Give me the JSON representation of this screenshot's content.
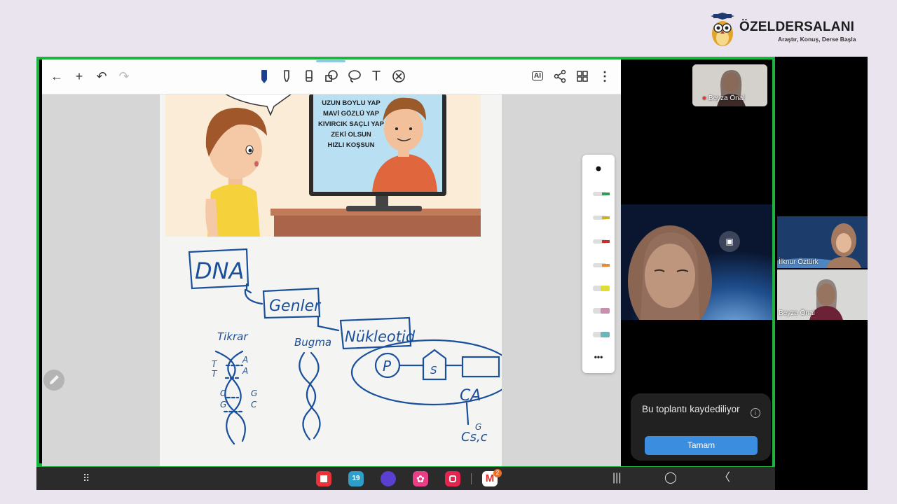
{
  "brand": {
    "name": "ÖZELDERSALANI",
    "tagline": "Araştır, Konuş, Derse Başla"
  },
  "toolbar": {
    "left_icons": [
      "back-arrow-icon",
      "plus-icon",
      "undo-icon",
      "redo-icon"
    ],
    "center_icons": [
      "pen-icon",
      "highlighter-icon",
      "eraser-icon",
      "shapes-icon",
      "lasso-icon",
      "text-icon",
      "close-circle-icon"
    ],
    "right_icons": [
      "ai-icon",
      "share-icon",
      "grid-icon",
      "more-vertical-icon"
    ],
    "ai_label": "AI"
  },
  "illustration": {
    "tv_lines": [
      "UZUN BOYLU YAP",
      "MAVİ GÖZLÜ YAP",
      "KIVIRCIK SAÇLI YAP",
      "ZEKİ OLSUN",
      "HIZLI KOŞSUN"
    ]
  },
  "handwriting": {
    "dna": "DNA",
    "genler": "Genler",
    "nukleotid": "Nükleotid",
    "tikrar": "Tikrar",
    "bugma": "Bugma",
    "p": "P",
    "s": "S",
    "ca": "CA",
    "g": "G",
    "csc": "Cs,c",
    "dna_letters": [
      "T",
      "A",
      "T",
      "A",
      "C",
      "G",
      "G",
      "C"
    ]
  },
  "pen_panel": {
    "colors": [
      "#111111",
      "#2e9d55",
      "#c9b320",
      "#c92d2d",
      "#e98a32",
      "#dedd36",
      "#c98fb1",
      "#6ab7b3"
    ],
    "more_label": "•••"
  },
  "participants": [
    {
      "name": "Beyza Önal",
      "muted": true
    },
    {
      "name": "İlknur Öztürk"
    },
    {
      "name": "Beyza Önal"
    }
  ],
  "toast": {
    "message": "Bu toplantı kaydediliyor",
    "button": "Tamam",
    "info_icon": "i"
  },
  "taskbar": {
    "apps": [
      "flipboard-icon",
      "calendar-icon",
      "internet-icon",
      "bixby-icon",
      "camera-icon",
      "gmail-icon"
    ],
    "calendar_day": "19",
    "gmail_badge": "2",
    "nav": [
      "recent-apps-icon",
      "home-icon",
      "back-icon"
    ]
  },
  "colors": {
    "frame_green": "#1db33f",
    "ink_blue": "#1a4f9c",
    "toast_button": "#3b8de0"
  }
}
